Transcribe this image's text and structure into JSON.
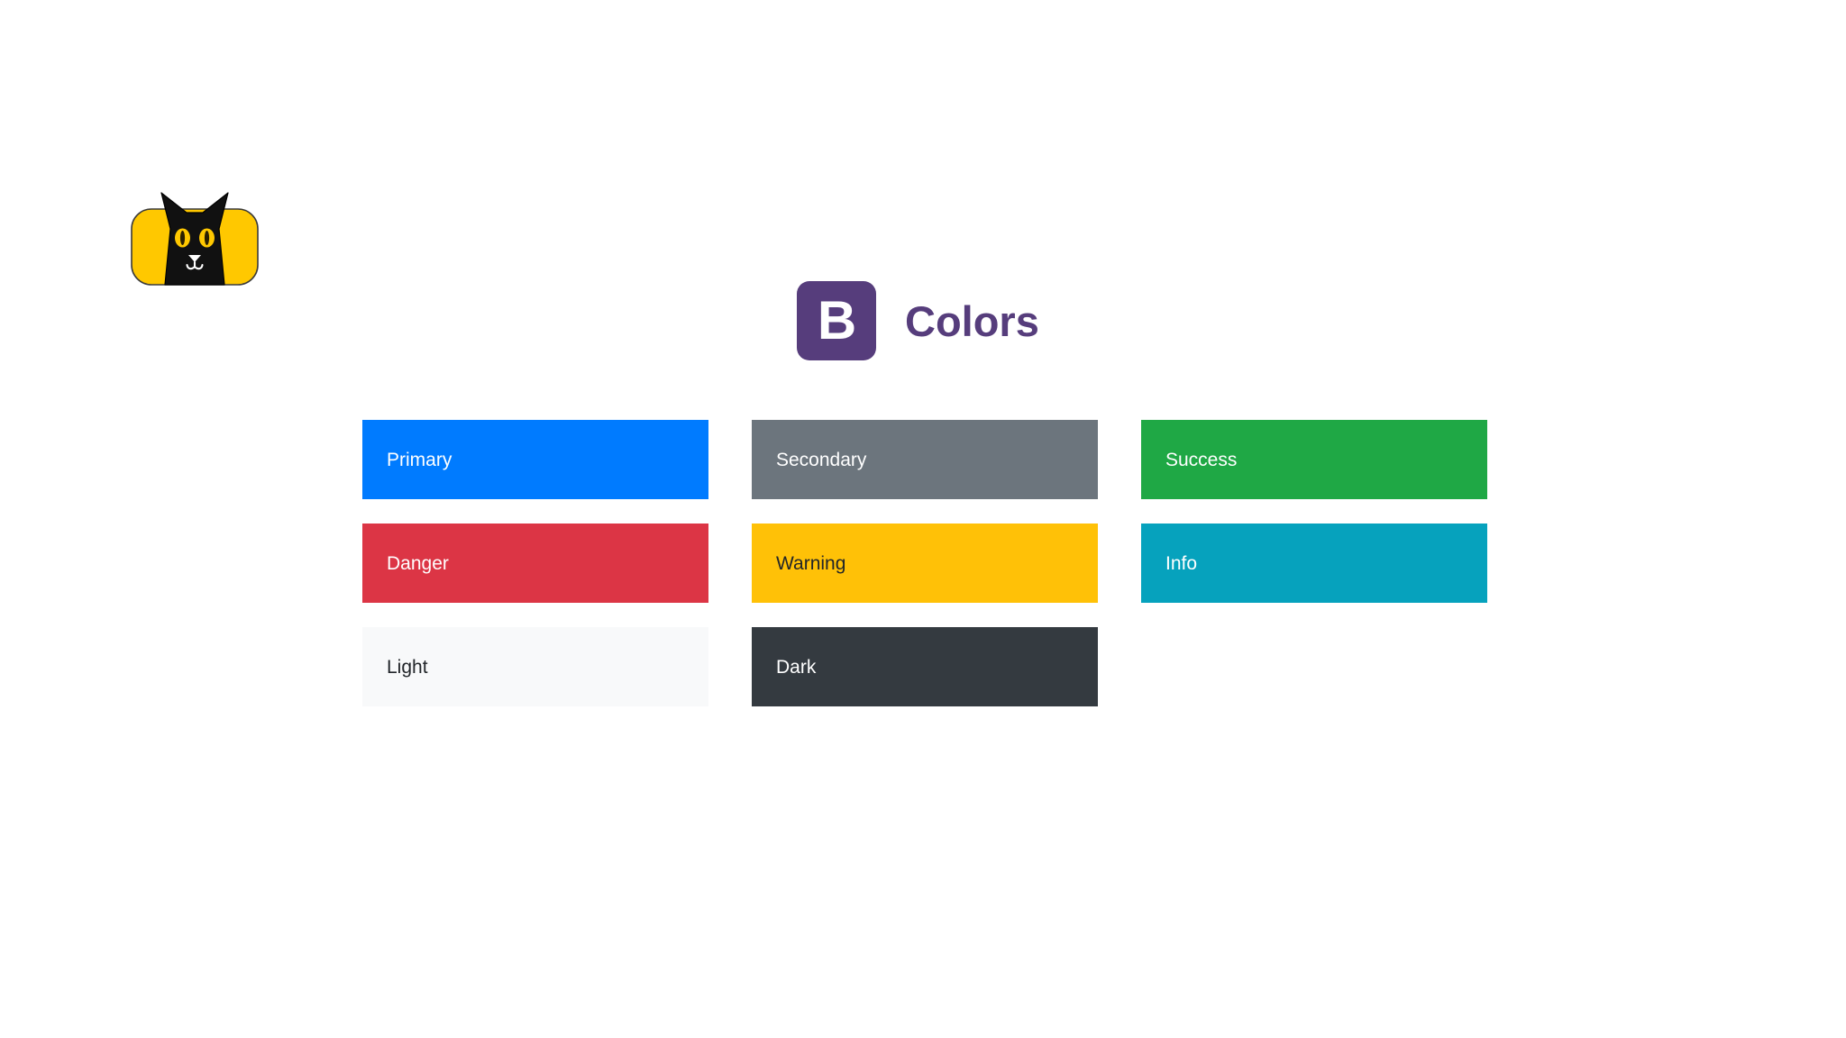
{
  "page": {
    "background": "#ffffff"
  },
  "logo": {
    "name": "black-cat-logo",
    "background": "#ffc800",
    "cat_color": "#111111",
    "eye_color": "#ffc800",
    "face_color": "#ffffff"
  },
  "header": {
    "mark_letter": "B",
    "mark_background": "#563d7c",
    "mark_text_color": "#ffffff",
    "title": "Colors",
    "title_color": "#563d7c"
  },
  "swatches": [
    {
      "label": "Primary",
      "background": "#007bff",
      "text_color": "#ffffff"
    },
    {
      "label": "Secondary",
      "background": "#6c757d",
      "text_color": "#ffffff"
    },
    {
      "label": "Success",
      "background": "#1fa845",
      "text_color": "#ffffff"
    },
    {
      "label": "Danger",
      "background": "#dc3545",
      "text_color": "#ffffff"
    },
    {
      "label": "Warning",
      "background": "#ffc107",
      "text_color": "#212529"
    },
    {
      "label": "Info",
      "background": "#06a2bd",
      "text_color": "#ffffff"
    },
    {
      "label": "Light",
      "background": "#f8f9fa",
      "text_color": "#212529"
    },
    {
      "label": "Dark",
      "background": "#343a40",
      "text_color": "#ffffff"
    }
  ]
}
